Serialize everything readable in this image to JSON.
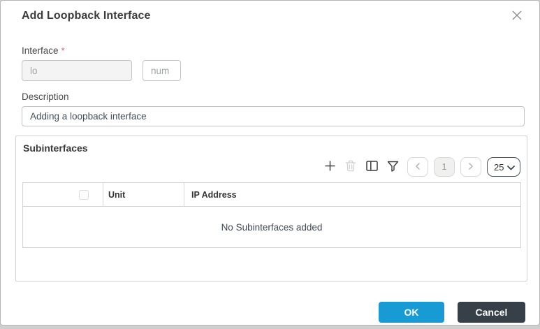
{
  "dialog": {
    "title": "Add Loopback Interface"
  },
  "form": {
    "interface": {
      "label": "Interface",
      "required_mark": "*",
      "name_value": "lo",
      "num_placeholder": "num"
    },
    "description": {
      "label": "Description",
      "value": "Adding a loopback interface"
    }
  },
  "subinterfaces": {
    "title": "Subinterfaces",
    "pagination": {
      "current_page": "1",
      "page_size": "25"
    },
    "table": {
      "unit_header": "Unit",
      "ip_header": "IP Address",
      "empty_message": "No Subinterfaces added"
    }
  },
  "footer": {
    "ok_label": "OK",
    "cancel_label": "Cancel"
  },
  "colors": {
    "ok_button": "#189AD4",
    "cancel_button": "#374049",
    "required_asterisk": "#E25C6A",
    "disabled_input_bg": "#F4F4F4"
  }
}
